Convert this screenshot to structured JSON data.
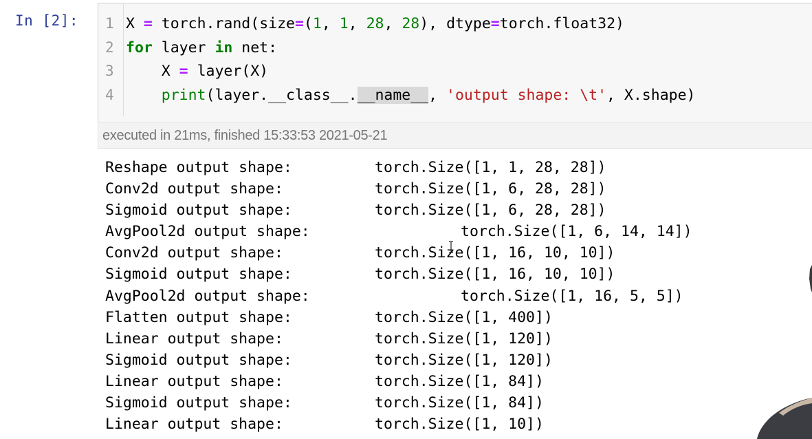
{
  "cell": {
    "prompt": "In [2]:",
    "line_numbers": [
      "1",
      "2",
      "3",
      "4"
    ],
    "code": {
      "line1": {
        "var": "X",
        "eq": "=",
        "call": " torch.rand(size",
        "eq2": "=",
        "open": "(",
        "n1": "1",
        "c1": ", ",
        "n2": "1",
        "c2": ", ",
        "n3": "28",
        "c3": ", ",
        "n4": "28",
        "rest": "), dtype",
        "eq3": "=",
        "tail": "torch.float32)"
      },
      "line2": {
        "kw_for": "for",
        "mid": " layer ",
        "kw_in": "in",
        "tail": " net:"
      },
      "line3": {
        "indent": "    X ",
        "eq": "=",
        "tail": " layer(X)"
      },
      "line4": {
        "indent": "    ",
        "fn": "print",
        "a": "(layer.",
        "dunder_class": "__class__",
        "dot": ".",
        "dunder_name": "__name__",
        "comma": ", ",
        "str": "'output shape: \\t'",
        "tail": ", X.shape)"
      }
    },
    "execution_info": "executed in 21ms, finished 15:33:53 2021-05-21"
  },
  "output_rows": [
    {
      "label": "Reshape output shape:",
      "value": "torch.Size([1, 1, 28, 28])"
    },
    {
      "label": "Conv2d output shape:",
      "value": "torch.Size([1, 6, 28, 28])"
    },
    {
      "label": "Sigmoid output shape:",
      "value": "torch.Size([1, 6, 28, 28])"
    },
    {
      "label": "AvgPool2d output shape:",
      "value": "torch.Size([1, 6, 14, 14])"
    },
    {
      "label": "Conv2d output shape:",
      "value": "torch.Size([1, 16, 10, 10])"
    },
    {
      "label": "Sigmoid output shape:",
      "value": "torch.Size([1, 16, 10, 10])"
    },
    {
      "label": "AvgPool2d output shape:",
      "value": "torch.Size([1, 16, 5, 5])"
    },
    {
      "label": "Flatten output shape:",
      "value": "torch.Size([1, 400])"
    },
    {
      "label": "Linear output shape:",
      "value": "torch.Size([1, 120])"
    },
    {
      "label": "Sigmoid output shape:",
      "value": "torch.Size([1, 120])"
    },
    {
      "label": "Linear output shape:",
      "value": "torch.Size([1, 84])"
    },
    {
      "label": "Sigmoid output shape:",
      "value": "torch.Size([1, 84])"
    },
    {
      "label": "Linear output shape:",
      "value": "torch.Size([1, 10])"
    }
  ],
  "icons": {
    "cursor": "text-cursor-icon"
  },
  "colors": {
    "prompt": "#303f9f",
    "keyword": "#008000",
    "operator": "#aa22ff",
    "string": "#ba2121",
    "input_background": "#f7f7f7"
  }
}
